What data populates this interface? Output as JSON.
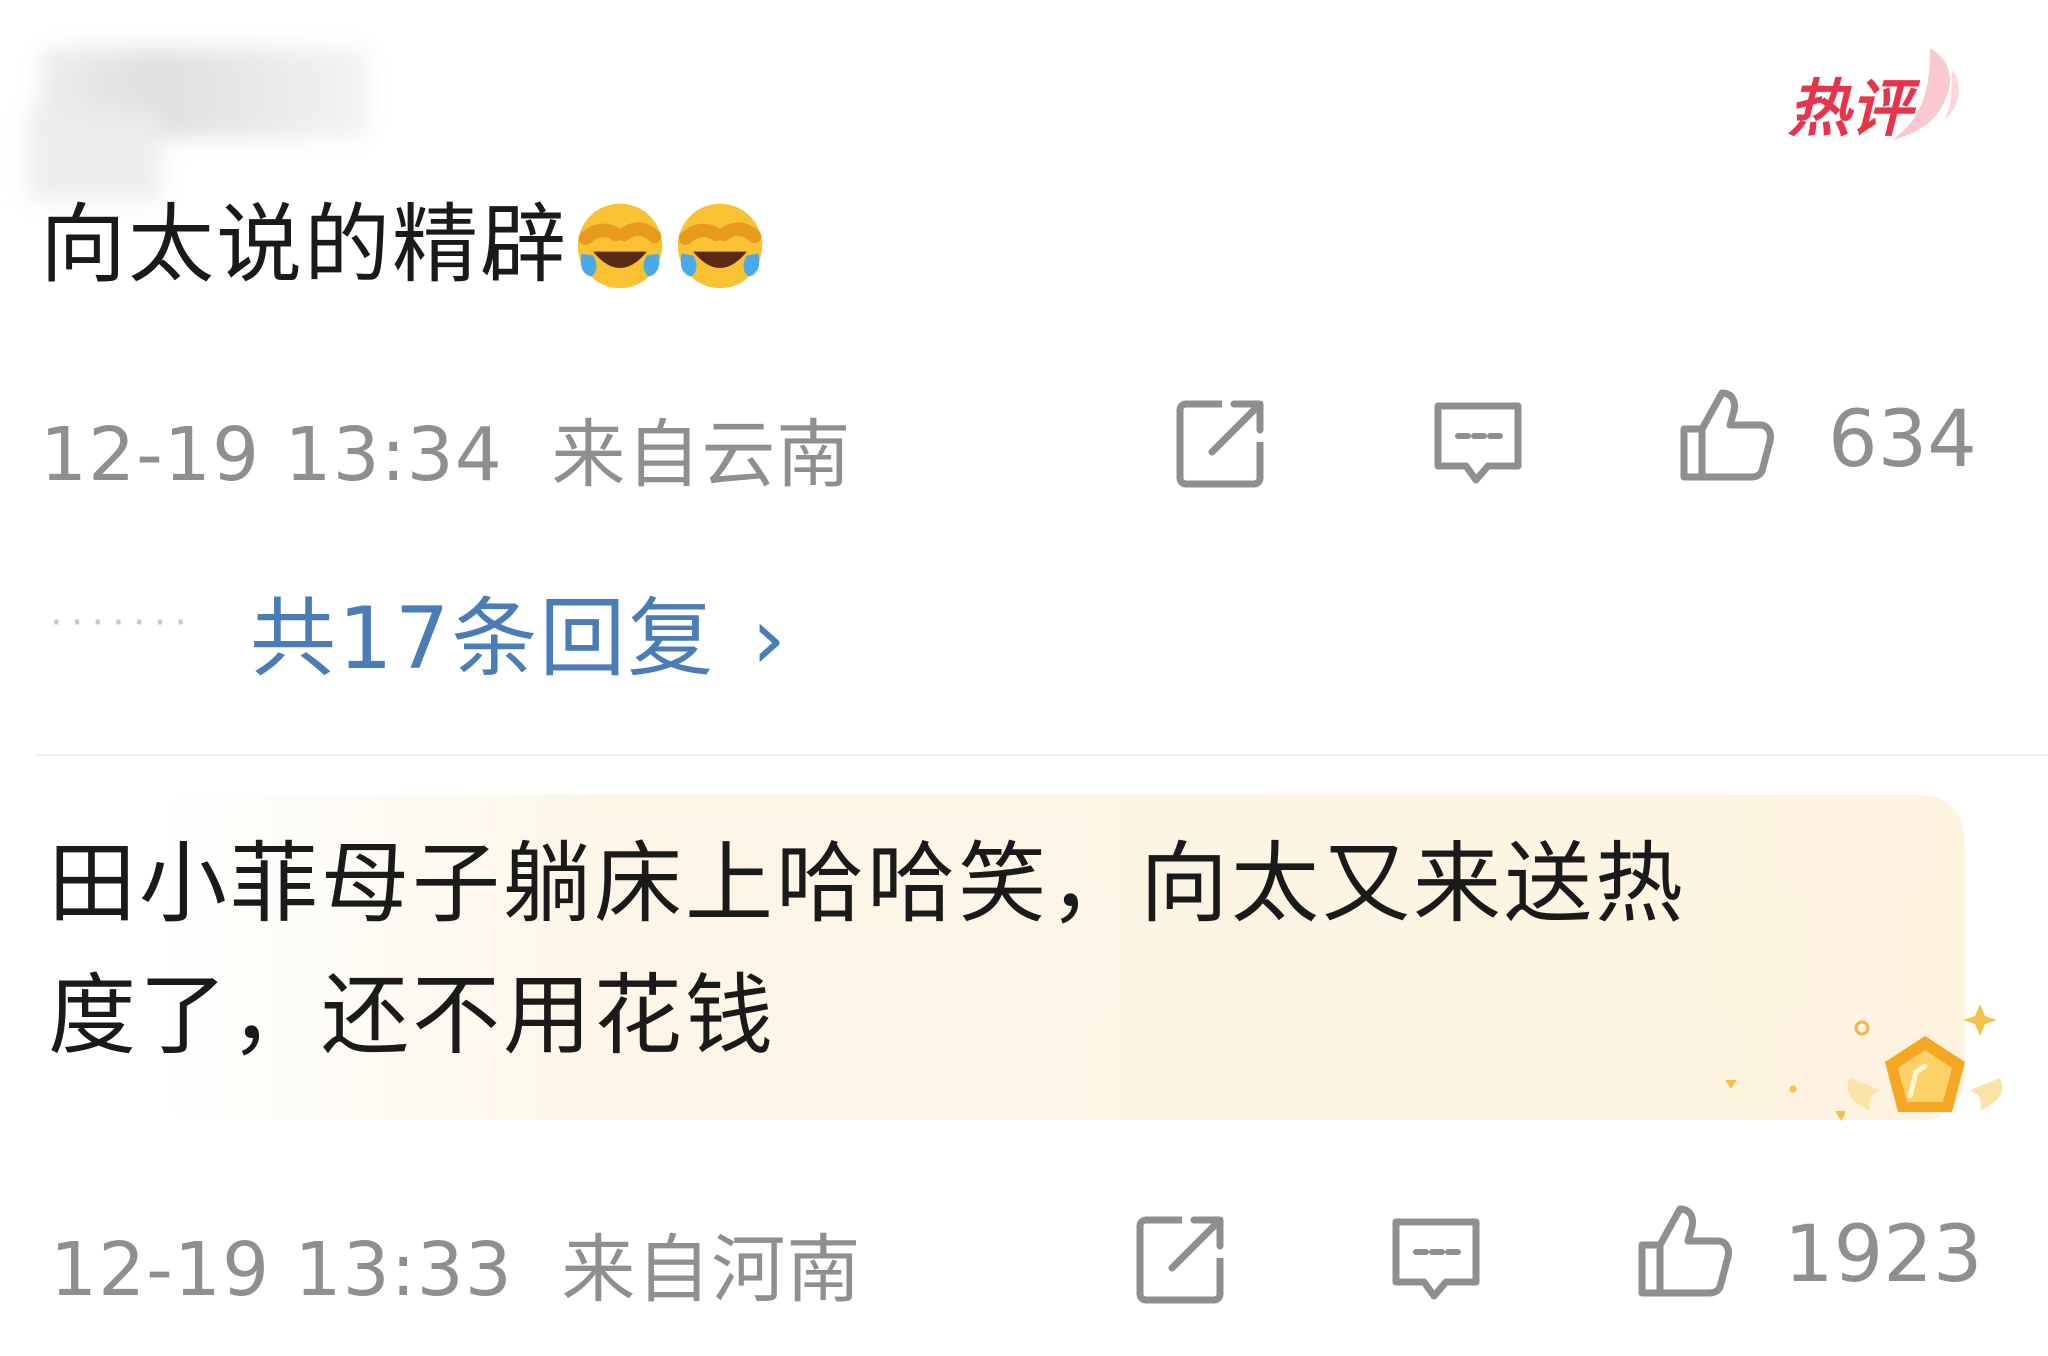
{
  "comments": [
    {
      "badge": "热评",
      "text": "向太说的精辟",
      "emojis": [
        "laugh-cry-emoji",
        "laugh-cry-emoji"
      ],
      "time": "12-19 13:34",
      "location": "来自云南",
      "likes": "634",
      "replies": "共17条回复",
      "reply_chevron": "›"
    },
    {
      "text_line1": "田小菲母子躺床上哈哈笑，向太又来送热",
      "text_line2": "度了，还不用花钱",
      "time": "12-19 13:33",
      "location": "来自河南",
      "likes": "1923"
    }
  ],
  "colors": {
    "text": "#1a1a1a",
    "meta": "#8f8f8f",
    "link": "#4a7db8",
    "hot": "#e8344a"
  },
  "icons": [
    "share-icon",
    "comment-icon",
    "like-icon",
    "medal-icon"
  ]
}
